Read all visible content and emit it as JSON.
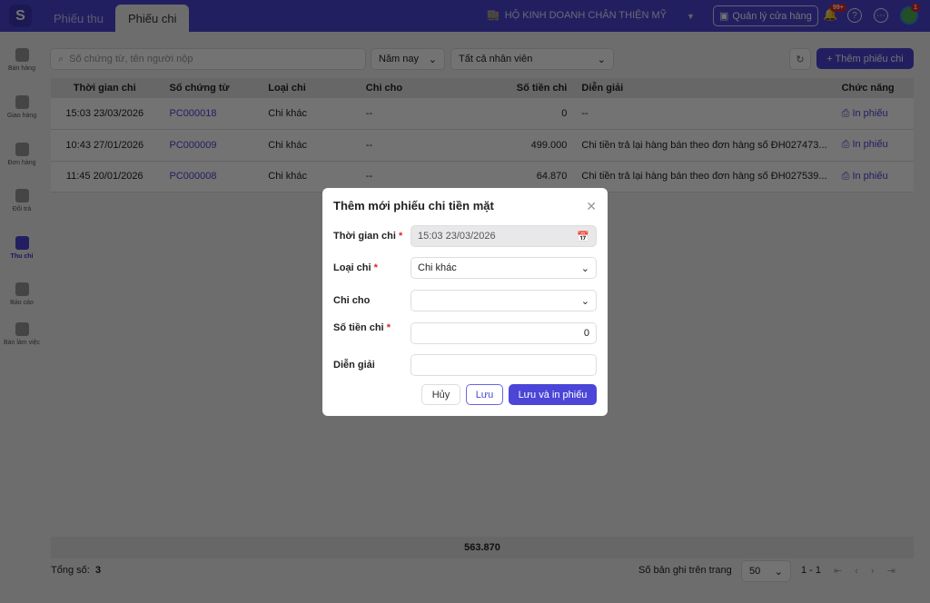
{
  "header": {
    "tabs": [
      "Phiếu thu",
      "Phiếu chi"
    ],
    "store": "HỘ KINH DOANH CHÂN THIỆN MỸ",
    "manage_store": "Quản lý cửa hàng",
    "notif_badge": "99+",
    "avatar_badge": "1"
  },
  "sidebar": [
    "Bán hàng",
    "Giao hàng",
    "Đơn hàng",
    "Đổi trả",
    "Thu chi",
    "Báo cáo",
    "Bàn làm việc"
  ],
  "toolbar": {
    "search_placeholder": "Số chứng từ, tên người nộp",
    "period": "Năm nay",
    "staff": "Tất cả nhân viên",
    "add_label": "+ Thêm phiếu chi"
  },
  "table": {
    "headers": [
      "Thời gian chi",
      "Số chứng từ",
      "Loại chi",
      "Chi cho",
      "Số tiền chi",
      "Diễn giải",
      "Chức năng"
    ],
    "rows": [
      [
        "15:03 23/03/2026",
        "PC000018",
        "Chi khác",
        "--",
        "0",
        "--",
        "In phiếu"
      ],
      [
        "10:43 27/01/2026",
        "PC000009",
        "Chi khác",
        "--",
        "499.000",
        "Chi tiền trả lại hàng bán theo đơn hàng số ĐH027473...",
        "In phiếu"
      ],
      [
        "11:45 20/01/2026",
        "PC000008",
        "Chi khác",
        "--",
        "64.870",
        "Chi tiền trả lại hàng bán theo đơn hàng số ĐH027539...",
        "In phiếu"
      ]
    ],
    "total": "563.870"
  },
  "footer": {
    "total_label": "Tổng số:",
    "total_count": "3",
    "per_page_label": "Số bản ghi trên trang",
    "per_page": "50",
    "range": "1 - 1"
  },
  "modal": {
    "title": "Thêm mới phiếu chi tiền mặt",
    "fields": [
      {
        "label": "Thời gian chi",
        "value": "15:03 23/03/2026"
      },
      {
        "label": "Loại chi",
        "value": "Chi khác"
      },
      {
        "label": "Chi cho",
        "value": ""
      },
      {
        "label": "Số tiền chi",
        "value": "0"
      },
      {
        "label": "Diễn giải",
        "value": ""
      }
    ],
    "cancel": "Hủy",
    "save": "Lưu",
    "save_print": "Lưu và in phiếu"
  }
}
